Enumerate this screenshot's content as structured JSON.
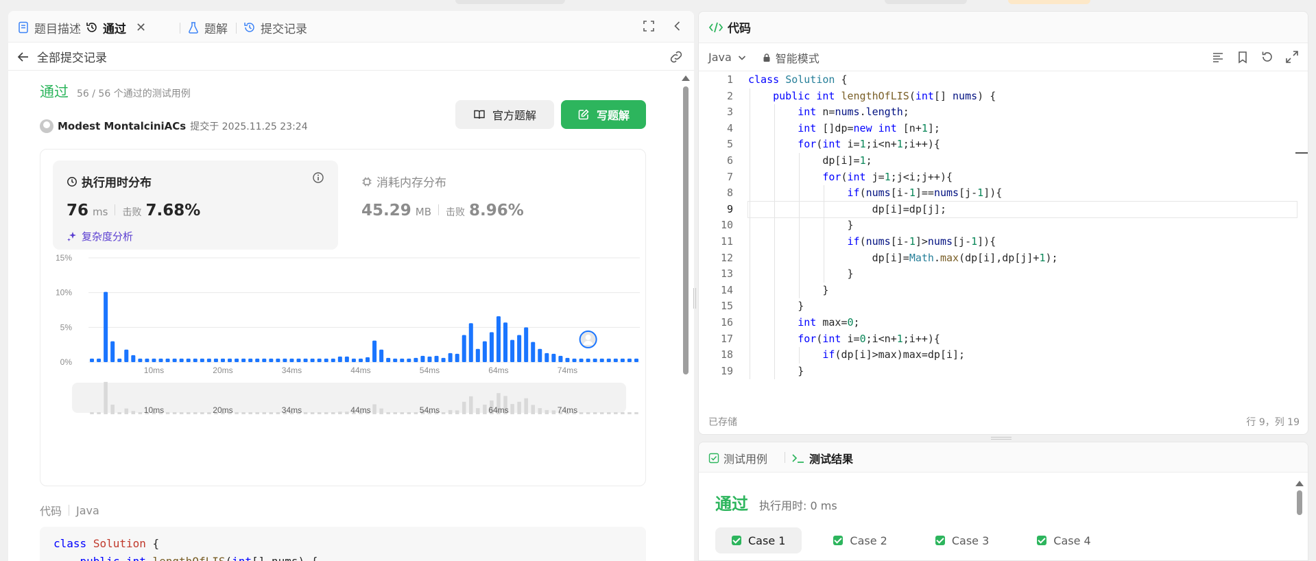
{
  "left_tabs": [
    {
      "label": "题目描述",
      "icon": "description-icon"
    },
    {
      "label": "通过",
      "icon": "history-icon",
      "active": true
    },
    {
      "label": "题解",
      "icon": "flask-icon"
    },
    {
      "label": "提交记录",
      "icon": "history-icon"
    }
  ],
  "back": {
    "label": "全部提交记录"
  },
  "submission": {
    "status": "通过",
    "passed_text": "56 / 56 个通过的测试用例",
    "author": "Modest MontalciniACs",
    "submitted": "提交于 2025.11.25 23:24"
  },
  "buttons": {
    "official": "官方题解",
    "write": "写题解"
  },
  "runtime": {
    "title": "执行用时分布",
    "value": "76",
    "unit": "ms",
    "beat_label": "击败",
    "beat": "7.68%",
    "complexity": "复杂度分析"
  },
  "memory": {
    "title": "消耗内存分布",
    "value": "45.29",
    "unit": "MB",
    "beat_label": "击败",
    "beat": "8.96%"
  },
  "chart_data": {
    "type": "bar",
    "ylim": [
      0,
      15
    ],
    "yticks": [
      "15%",
      "10%",
      "5%",
      "0%"
    ],
    "ytick_values": [
      15,
      10,
      5,
      0
    ],
    "xticks": [
      "10ms",
      "20ms",
      "34ms",
      "44ms",
      "54ms",
      "64ms",
      "74ms"
    ],
    "xtick_index": [
      9,
      19,
      29,
      39,
      49,
      59,
      69
    ],
    "values": [
      0.5,
      0.5,
      10.1,
      3.0,
      0.5,
      1.8,
      1.0,
      0.5,
      0.5,
      0.5,
      0.5,
      0.5,
      0.5,
      0.5,
      0.5,
      0.5,
      0.5,
      0.5,
      0.5,
      0.5,
      0.5,
      0.5,
      0.5,
      0.5,
      0.5,
      0.5,
      0.5,
      0.5,
      0.5,
      0.5,
      0.5,
      0.5,
      0.5,
      0.5,
      0.5,
      0.5,
      0.8,
      0.8,
      0.5,
      0.5,
      0.7,
      3.1,
      1.8,
      0.6,
      0.5,
      0.5,
      0.5,
      0.6,
      0.9,
      0.8,
      0.9,
      0.6,
      1.3,
      1.2,
      3.9,
      5.6,
      1.9,
      3.0,
      4.3,
      6.6,
      5.7,
      3.2,
      3.9,
      5.0,
      2.9,
      1.9,
      1.3,
      1.2,
      0.9,
      0.6,
      0.5,
      0.5,
      0.5,
      0.5,
      0.5,
      0.5,
      0.5,
      0.5,
      0.5,
      0.5
    ],
    "highlight_index": 72,
    "bar_color": "#1a75ff",
    "grid": true
  },
  "code_section": {
    "label": "代码",
    "lang": "Java",
    "preview_line1": "class Solution {",
    "preview_line2": "    public int lengthOfLIS(int[] nums) {"
  },
  "editor": {
    "title": "代码",
    "lang": "Java",
    "mode": "智能模式",
    "saved": "已存储",
    "position": "行 9，列 19",
    "lines": [
      "class Solution {",
      "    public int lengthOfLIS(int[] nums) {",
      "        int n=nums.length;",
      "        int []dp=new int [n+1];",
      "        for(int i=1;i<n+1;i++){",
      "            dp[i]=1;",
      "            for(int j=1;j<i;j++){",
      "                if(nums[i-1]==nums[j-1]){",
      "                    dp[i]=dp[j];",
      "                }",
      "                if(nums[i-1]>nums[j-1]){",
      "                    dp[i]=Math.max(dp[i],dp[j]+1);",
      "                }",
      "            }",
      "        }",
      "        int max=0;",
      "        for(int i=0;i<n+1;i++){",
      "            if(dp[i]>max)max=dp[i];",
      "        }"
    ],
    "current_line": 9
  },
  "bottom_tabs": [
    {
      "label": "测试用例",
      "icon": "checkbox-icon"
    },
    {
      "label": "测试结果",
      "icon": "terminal-icon",
      "active": true
    }
  ],
  "result": {
    "status": "通过",
    "time": "执行用时: 0 ms"
  },
  "cases": [
    "Case 1",
    "Case 2",
    "Case 3",
    "Case 4"
  ],
  "colors": {
    "accent_green": "#2db55d",
    "bar_blue": "#1a75ff",
    "purple": "#5b3fd1"
  }
}
